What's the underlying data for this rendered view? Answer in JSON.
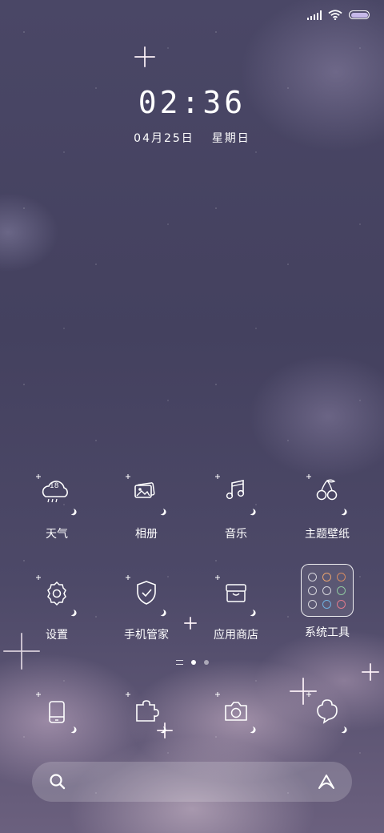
{
  "status_bar": {
    "battery_level": 1.0,
    "battery_fill_color": "#c6b9e9"
  },
  "clock": {
    "time": "02:36",
    "date": "04月25日",
    "weekday": "星期日"
  },
  "weather_widget": {
    "temperature": "18"
  },
  "apps": [
    {
      "label": "天气",
      "icon": "weather-icon"
    },
    {
      "label": "相册",
      "icon": "gallery-icon"
    },
    {
      "label": "音乐",
      "icon": "music-icon"
    },
    {
      "label": "主题壁纸",
      "icon": "cherry-icon"
    },
    {
      "label": "设置",
      "icon": "gear-icon"
    },
    {
      "label": "手机管家",
      "icon": "shield-icon"
    },
    {
      "label": "应用商店",
      "icon": "store-icon"
    }
  ],
  "folder": {
    "label": "系统工具",
    "item_count": 9
  },
  "pager": {
    "pages": 2,
    "current": 1
  },
  "dock": [
    {
      "icon": "phone-icon"
    },
    {
      "icon": "puzzle-icon"
    },
    {
      "icon": "camera-icon"
    },
    {
      "icon": "chat-bubble-icon"
    }
  ],
  "search_bar": {
    "left_icon": "search-icon",
    "right_icon": "assistant-icon"
  }
}
